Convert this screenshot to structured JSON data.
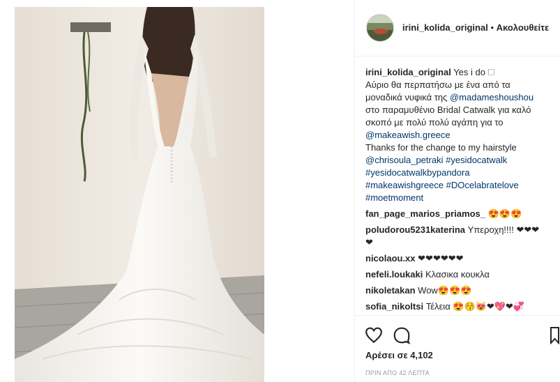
{
  "post": {
    "username": "irini_kolida_original",
    "follow_label": "Ακολουθείτε",
    "separator": "•"
  },
  "caption": {
    "username": "irini_kolida_original",
    "lines": [
      "Yes i do 🗆",
      "Αύριο θα περπατήσω με ένα από τα",
      "μοναδικά νυφικά της ",
      "στο παραμυθένιο Bridal Catwalk για καλό",
      "σκοπό με πολύ πολύ αγάπη για το",
      "Thanks for the change to my hairstyle"
    ],
    "mention_1": "@madameshoushou",
    "mention_2": "@makeawish.greece",
    "mention_3": "@chrisoula_petraki",
    "tag_1": "#yesidocatwalk",
    "tag_2": "#yesidocatwalkbypandora",
    "tag_3": "#makeawishgreece",
    "tag_4": "#DOcelabratelove",
    "tag_5": "#moetmoment"
  },
  "comments": [
    {
      "user": "fan_page_marios_priamos_",
      "text": "😍😍😍"
    },
    {
      "user": "poludorou5231katerina",
      "text": "Υπεροχη!!!! ❤❤❤"
    },
    {
      "user": "",
      "text": "❤"
    },
    {
      "user": "nicolaou.xx",
      "text": "❤❤❤❤❤❤"
    },
    {
      "user": "nefeli.loukaki",
      "text": "Κλασικα κουκλα"
    },
    {
      "user": "nikoletakan",
      "text": "Wow😍😍😍"
    },
    {
      "user": "sofia_nikoltsi",
      "text": "Τέλεια 😍😚😻❤💖❤💞"
    }
  ],
  "likes_text": "Αρέσει σε 4,102",
  "timestamp": "ΠΡΙΝ ΑΠΟ 42 ΛΕΠΤΑ",
  "icons": {
    "like": "heart-icon",
    "comment": "speech-bubble-icon",
    "save": "bookmark-icon"
  },
  "colors": {
    "link": "#003569",
    "text": "#262626",
    "muted": "#999999",
    "border": "#efefef"
  }
}
